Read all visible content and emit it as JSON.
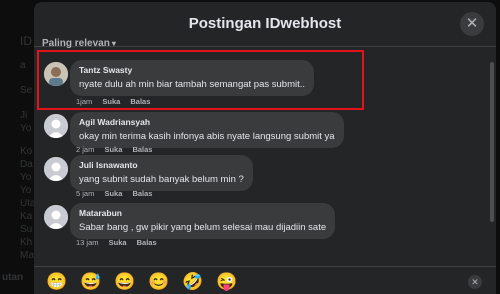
{
  "dialog": {
    "title": "Postingan IDwebhost",
    "close_glyph": "✕",
    "sort_label": "Paling relevan",
    "sort_chevron": "▾"
  },
  "background_fragments": [
    "ID",
    "a",
    "Se",
    "Ji",
    "Yo",
    "Ko",
    "Da",
    "Yo",
    "Yo",
    "Uta",
    "Ka",
    "Su",
    "Kh",
    "Ma",
    "utan"
  ],
  "comments": [
    {
      "author": "Tantz Swasty",
      "text": "nyate dulu ah min biar tambah semangat pas submit..",
      "time": "1jam",
      "like": "Suka",
      "reply": "Balas",
      "avatar": "photo-avatar",
      "highlighted": true
    },
    {
      "author": "Agil Wadriansyah",
      "text": "okay min terima kasih infonya abis nyate langsung submit ya",
      "time": "2 jam",
      "like": "Suka",
      "reply": "Balas",
      "avatar": "default-avatar"
    },
    {
      "author": "Juli Isnawanto",
      "text": "yang subnit sudah banyak belum min ?",
      "time": "5 jam",
      "like": "Suka",
      "reply": "Balas",
      "avatar": "default-avatar"
    },
    {
      "author": "Matarabun",
      "text": "Sabar bang , gw pikir yang belum selesai mau dijadiin sate",
      "time": "13 jam",
      "like": "Suka",
      "reply": "Balas",
      "avatar": "default-avatar"
    }
  ],
  "emoji_bar": {
    "emojis": [
      "😁",
      "😅",
      "😄",
      "😊",
      "🤣",
      "😜"
    ],
    "close_glyph": "✕"
  },
  "colors": {
    "modal_bg": "#242526",
    "bubble_bg": "#3a3b3c",
    "highlight_border": "#e0151b",
    "text_primary": "#e4e6eb",
    "text_secondary": "#b0b3b8"
  }
}
